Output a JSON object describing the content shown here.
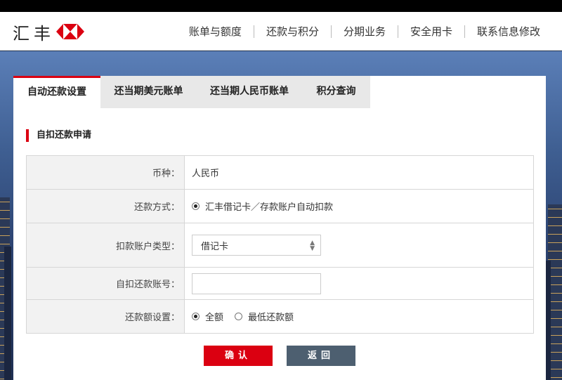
{
  "brand": {
    "name": "汇丰",
    "logo_color": "#db0011"
  },
  "nav": [
    "账单与额度",
    "还款与积分",
    "分期业务",
    "安全用卡",
    "联系信息修改"
  ],
  "tabs": [
    "自动还款设置",
    "还当期美元账单",
    "还当期人民币账单",
    "积分查询"
  ],
  "section_title": "自扣还款申请",
  "form": {
    "currency_label": "币种：",
    "currency_value": "人民币",
    "method_label": "还款方式：",
    "method_value": "汇丰借记卡／存款账户自动扣款",
    "account_type_label": "扣款账户类型：",
    "account_type_value": "借记卡",
    "account_no_label": "自扣还款账号：",
    "account_no_value": "",
    "amount_label": "还款额设置：",
    "amount_options": [
      "全额",
      "最低还款额"
    ],
    "amount_selected": "全额"
  },
  "buttons": {
    "confirm": "确认",
    "back": "返回"
  },
  "colors": {
    "accent": "#db0011",
    "secondary_button": "#4d5f70"
  }
}
